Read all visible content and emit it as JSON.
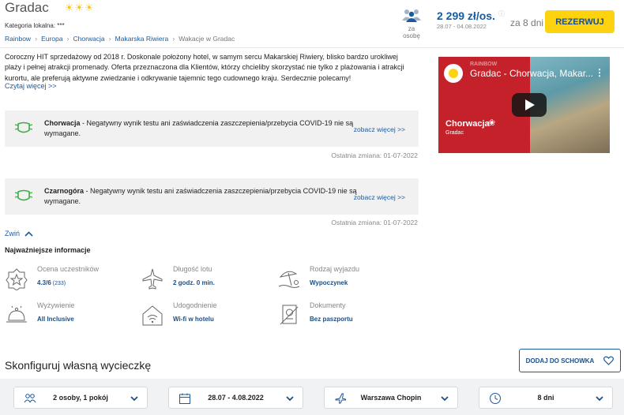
{
  "hotel": {
    "name": "Gradac",
    "stars": "☀☀☀",
    "local_category": "Kategoria lokalna: ***"
  },
  "breadcrumb": [
    "Rainbow",
    "Europa",
    "Chorwacja",
    "Makarska Riwiera",
    "Wakacje w Gradac"
  ],
  "offer": {
    "persons_label": "za osobę",
    "price": "2 299 zł/os.",
    "dates": "28.07 - 04.08.2022",
    "duration": "za 8 dni",
    "reserve_label": "REZERWUJ"
  },
  "description": {
    "text": "Coroczny HIT sprzedażowy od 2018 r. Doskonale położony hotel, w samym sercu Makarskiej Riwiery, blisko bardzo urokliwej plaży i pełnej atrakcji promenady. Oferta przeznaczona dla Klientów, którzy chcieliby skorzystać nie tylko z plażowania i atrakcji kurortu, ale preferują aktywne zwiedzanie i odkrywanie tajemnic tego cudownego kraju. Serdecznie polecamy!",
    "more_label": "Czytaj więcej >>"
  },
  "covid": [
    {
      "country": "Chorwacja",
      "text": " - Negatywny wynik testu ani zaświadczenia zaszczepienia/przebycia COVID-19 nie są wymagane.",
      "link": "zobacz więcej >>",
      "last_change": "Ostatnia zmiana: 01-07-2022"
    },
    {
      "country": "Czarnogóra",
      "text": " - Negatywny wynik testu ani zaświadczenia zaszczepienia/przebycia COVID-19 nie są wymagane.",
      "link": "zobacz więcej >>",
      "last_change": "Ostatnia zmiana: 01-07-2022"
    }
  ],
  "video": {
    "title": "Gradac - Chorwacja, Makar...",
    "watermark": "RAINBOW",
    "country": "Chorwacja",
    "city": "Gradac"
  },
  "collapse_label": "Zwiń",
  "info": {
    "title": "Najważniejsze informacje",
    "items": [
      {
        "key": "Ocena uczestników",
        "value": "4.3/6",
        "extra": " (233)",
        "icon": "star-badge-icon"
      },
      {
        "key": "Długość lotu",
        "value": "2 godz. 0 min.",
        "icon": "plane-icon"
      },
      {
        "key": "Rodzaj wyjazdu",
        "value": "Wypoczynek",
        "icon": "beach-umbrella-icon"
      },
      {
        "key": "Wyżywienie",
        "value": "All Inclusive",
        "icon": "cloche-icon"
      },
      {
        "key": "Udogodnienie",
        "value": "Wi-fi w hotelu",
        "icon": "wifi-house-icon"
      },
      {
        "key": "Dokumenty",
        "value": "Bez paszportu",
        "icon": "passport-icon"
      }
    ]
  },
  "configure": {
    "title": "Skonfiguruj własną wycieczkę",
    "clipboard_label": "DODAJ DO SCHOWKA",
    "selects": [
      {
        "value": "2 osoby, 1 pokój",
        "icon": "people-icon"
      },
      {
        "value": "28.07 - 4.08.2022",
        "icon": "calendar-icon"
      },
      {
        "value": "Warszawa Chopin",
        "icon": "plane-icon"
      },
      {
        "value": "8 dni",
        "icon": "clock-icon"
      }
    ]
  },
  "colors": {
    "accent": "#1b5a9c",
    "reserve": "#fdd30f",
    "mask": "#3fae49"
  }
}
